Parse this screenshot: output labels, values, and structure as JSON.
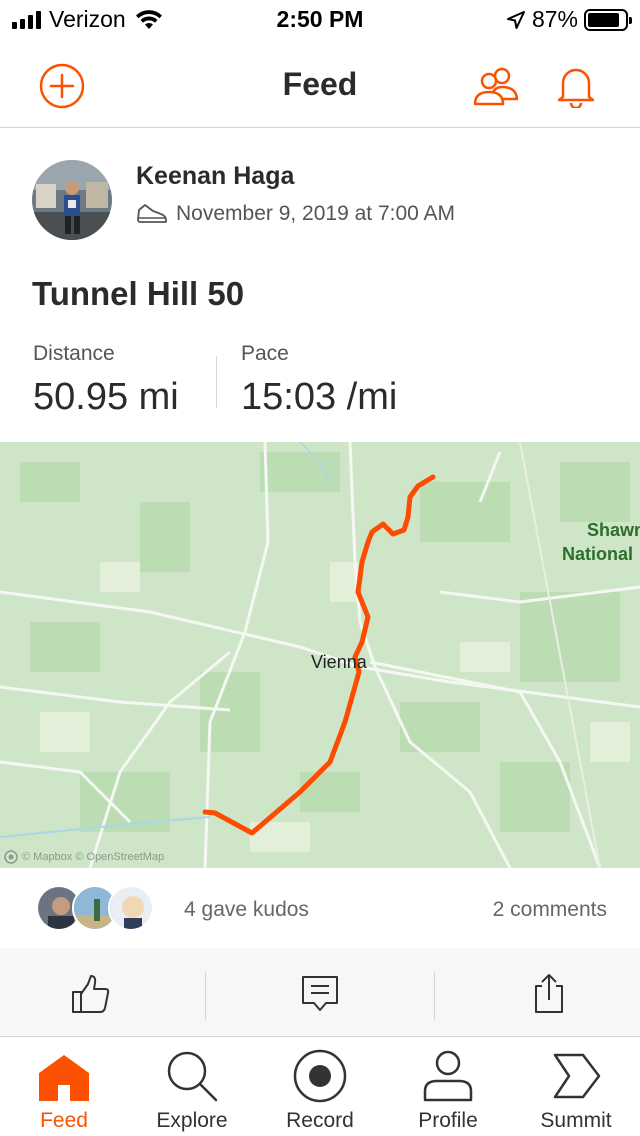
{
  "status_bar": {
    "carrier": "Verizon",
    "time": "2:50 PM",
    "battery_pct": "87%"
  },
  "header": {
    "title": "Feed"
  },
  "activity": {
    "athlete": "Keenan Haga",
    "datetime": "November 9, 2019 at 7:00 AM",
    "title": "Tunnel Hill 50",
    "stats": [
      {
        "label": "Distance",
        "value": "50.95 mi"
      },
      {
        "label": "Pace",
        "value": "15:03 /mi"
      }
    ],
    "map": {
      "labels": [
        "Vienna",
        "Shawnee",
        "National"
      ],
      "attribution": "© Mapbox © OpenStreetMap"
    }
  },
  "social": {
    "kudos_text": "4 gave kudos",
    "comments_text": "2 comments"
  },
  "tabs": [
    {
      "label": "Feed",
      "icon": "home-icon",
      "active": true
    },
    {
      "label": "Explore",
      "icon": "search-icon",
      "active": false
    },
    {
      "label": "Record",
      "icon": "record-icon",
      "active": false
    },
    {
      "label": "Profile",
      "icon": "person-icon",
      "active": false
    },
    {
      "label": "Summit",
      "icon": "summit-chevron-icon",
      "active": false
    }
  ],
  "colors": {
    "brand": "#fc5200",
    "route": "#fc4c02",
    "map_green": "#cfe5c8"
  }
}
